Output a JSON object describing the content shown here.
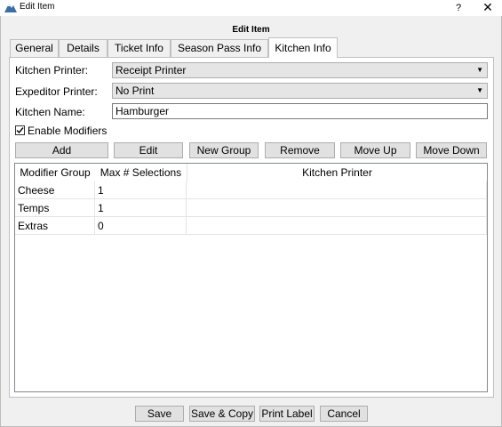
{
  "window": {
    "title": "Edit Item",
    "help_label": "?",
    "close_label": "✕"
  },
  "header": {
    "title": "Edit Item"
  },
  "tabs": [
    {
      "label": "General"
    },
    {
      "label": "Details"
    },
    {
      "label": "Ticket Info"
    },
    {
      "label": "Season Pass Info"
    },
    {
      "label": "Kitchen Info",
      "active": true
    }
  ],
  "kitchen": {
    "printer_label": "Kitchen Printer:",
    "printer_value": "Receipt Printer",
    "expeditor_label": "Expeditor Printer:",
    "expeditor_value": "No Print",
    "name_label": "Kitchen Name:",
    "name_value": "Hamburger",
    "enable_modifiers_label": "Enable Modifiers",
    "enable_modifiers_checked": true,
    "dropdown_arrow": "▼"
  },
  "toolbar": {
    "add": "Add",
    "edit": "Edit",
    "new_group": "New Group",
    "remove": "Remove",
    "move_up": "Move Up",
    "move_down": "Move Down"
  },
  "grid": {
    "columns": [
      "Modifier Group",
      "Max # Selections",
      "Kitchen Printer"
    ],
    "rows": [
      [
        "Cheese",
        "1",
        ""
      ],
      [
        "Temps",
        "1",
        ""
      ],
      [
        "Extras",
        "0",
        ""
      ]
    ]
  },
  "footer": {
    "save": "Save",
    "save_copy": "Save & Copy",
    "print_label": "Print Label",
    "cancel": "Cancel"
  },
  "colors": {
    "window_bg": "#f0f0f0",
    "panel_bg": "#ffffff",
    "button_bg": "#e1e1e1",
    "combo_bg": "#e5e5e5",
    "app_icon": "#3a6ea5"
  }
}
